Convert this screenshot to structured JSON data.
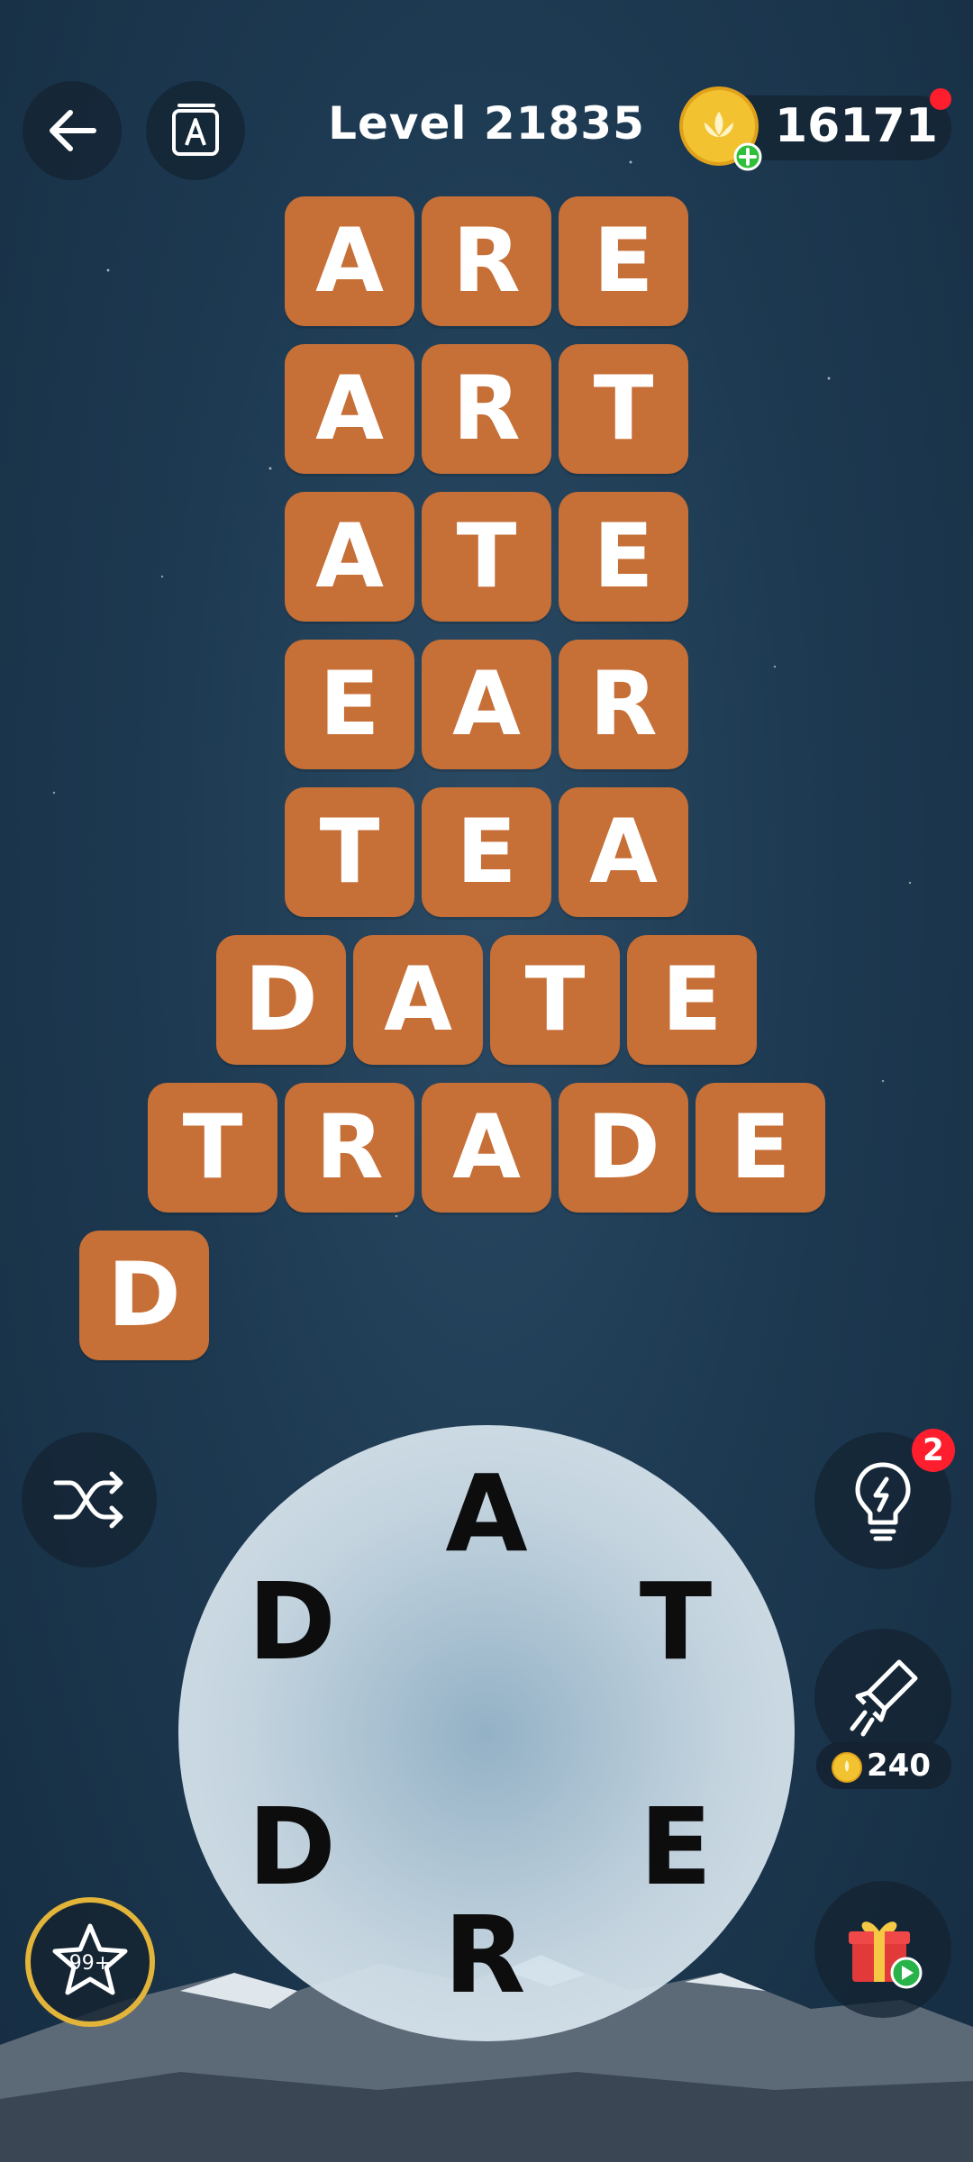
{
  "header": {
    "level_title": "Level 21835",
    "coins": "16171",
    "icons": {
      "back": "arrow-left-icon",
      "dictionary": "dictionary-icon",
      "coin": "lotus-coin-icon",
      "add": "plus-icon"
    },
    "colors": {
      "notify": "#ff1e2d",
      "coin": "#f2c230",
      "add": "#2fbf3a"
    }
  },
  "board": {
    "tile_color": "#c66f37",
    "rows": [
      {
        "word": "ARE",
        "letters": [
          "A",
          "R",
          "E"
        ]
      },
      {
        "word": "ART",
        "letters": [
          "A",
          "R",
          "T"
        ]
      },
      {
        "word": "ATE",
        "letters": [
          "A",
          "T",
          "E"
        ]
      },
      {
        "word": "EAR",
        "letters": [
          "E",
          "A",
          "R"
        ]
      },
      {
        "word": "TEA",
        "letters": [
          "T",
          "E",
          "A"
        ]
      },
      {
        "word": "DATE",
        "letters": [
          "D",
          "A",
          "T",
          "E"
        ]
      },
      {
        "word": "TRADE",
        "letters": [
          "T",
          "R",
          "A",
          "D",
          "E"
        ]
      },
      {
        "word": "D",
        "letters": [
          "D"
        ]
      }
    ]
  },
  "wheel": {
    "letters": [
      "A",
      "T",
      "E",
      "R",
      "D",
      "D"
    ]
  },
  "controls": {
    "shuffle_icon": "shuffle-icon",
    "hint_icon": "lightbulb-icon",
    "hint_count": "2",
    "rocket_icon": "rocket-icon",
    "rocket_cost": "240",
    "gift_icon": "gift-icon",
    "stars_icon": "star-icon",
    "stars_label": "99+"
  }
}
